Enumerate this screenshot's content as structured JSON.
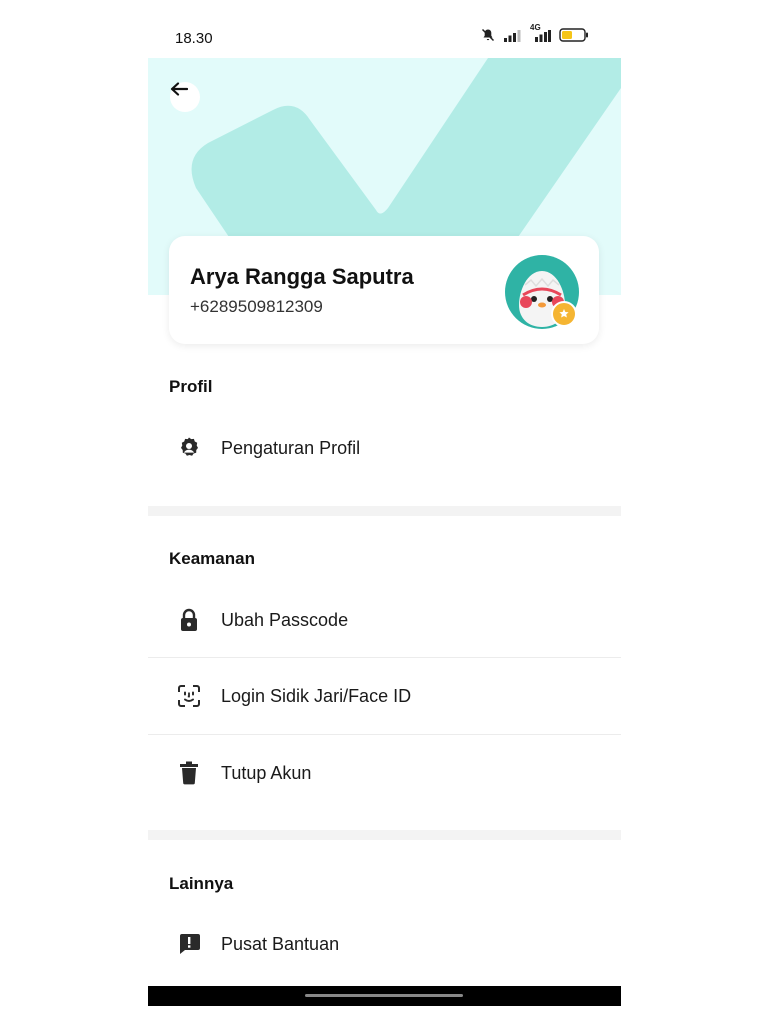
{
  "status_bar": {
    "time": "18.30",
    "network_label": "4G"
  },
  "profile": {
    "name": "Arya Rangga Saputra",
    "phone": "+6289509812309"
  },
  "sections": {
    "profil": {
      "title": "Profil",
      "items": [
        {
          "label": "Pengaturan Profil",
          "icon": "gear-icon"
        }
      ]
    },
    "keamanan": {
      "title": "Keamanan",
      "items": [
        {
          "label": "Ubah Passcode",
          "icon": "lock-icon"
        },
        {
          "label": "Login Sidik Jari/Face ID",
          "icon": "face-id-icon"
        },
        {
          "label": "Tutup Akun",
          "icon": "trash-icon"
        }
      ]
    },
    "lainnya": {
      "title": "Lainnya",
      "items": [
        {
          "label": "Pusat Bantuan",
          "icon": "help-chat-icon"
        }
      ]
    }
  },
  "colors": {
    "hero_bg": "#e2fbfa",
    "hero_check": "#b2ece6",
    "avatar_bg": "#2fb3a5",
    "badge": "#f5b532",
    "battery": "#f5c518"
  }
}
